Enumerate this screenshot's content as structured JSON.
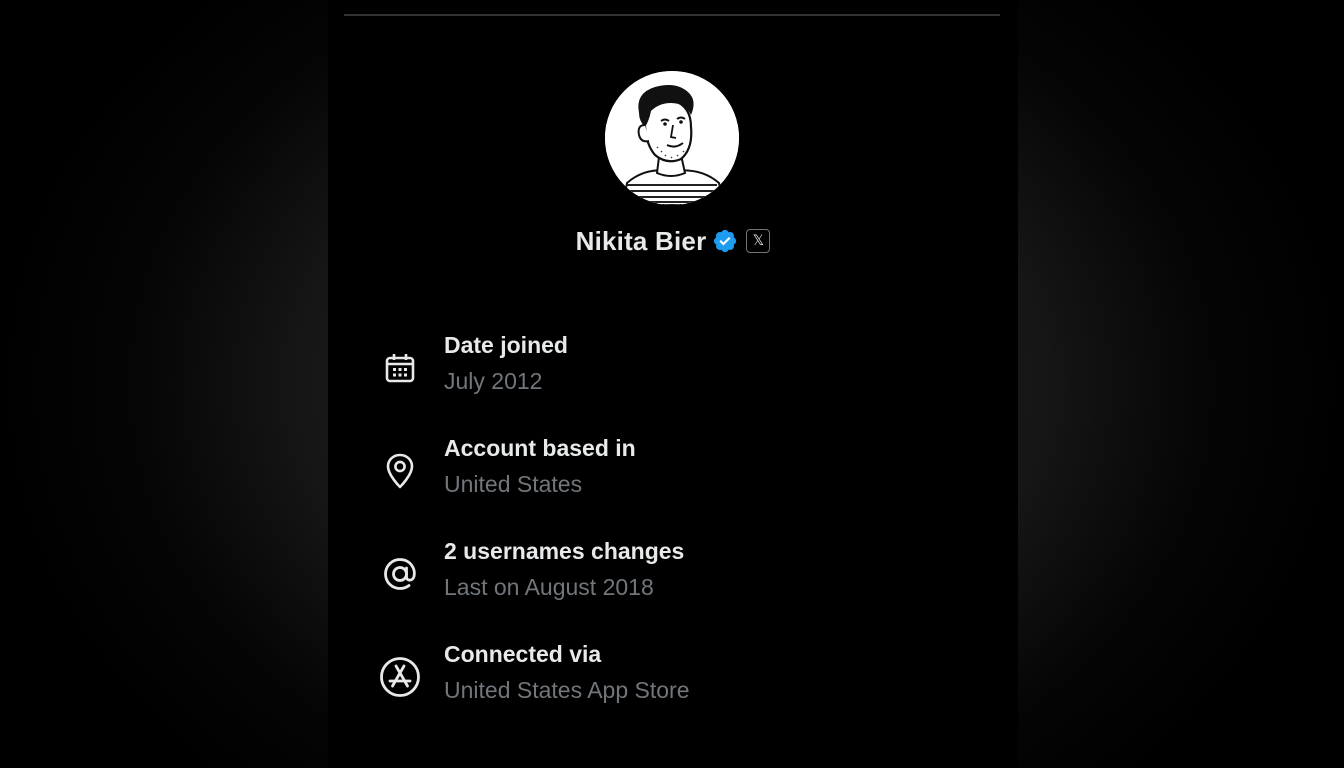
{
  "profile": {
    "display_name": "Nikita Bier",
    "verified": true,
    "verified_color": "#1d9bf0",
    "affiliate_badge": "𝕏"
  },
  "about": {
    "items": [
      {
        "icon": "calendar-icon",
        "title": "Date joined",
        "value": "July 2012"
      },
      {
        "icon": "location-pin-icon",
        "title": "Account based in",
        "value": "United States"
      },
      {
        "icon": "at-sign-icon",
        "title": "2 usernames changes",
        "value": "Last on August 2018"
      },
      {
        "icon": "app-store-icon",
        "title": "Connected via",
        "value": "United States App Store"
      }
    ]
  },
  "colors": {
    "background": "#000000",
    "primary_text": "#e7e9ea",
    "secondary_text": "#71767b",
    "divider": "#2f3336"
  }
}
